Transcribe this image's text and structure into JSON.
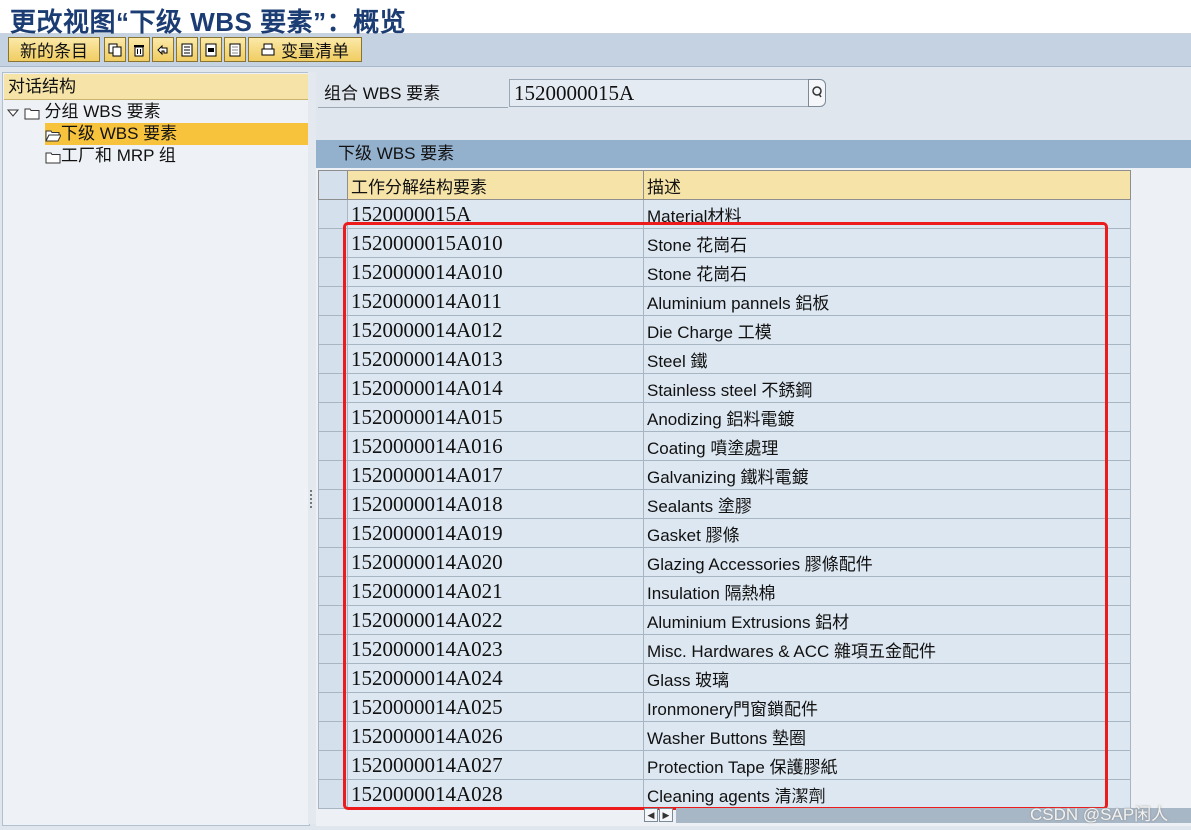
{
  "window": {
    "title": "更改视图“下级 WBS 要素”：概览"
  },
  "toolbar": {
    "new_entries": "新的条目",
    "variable_list": "变量清单",
    "icons": [
      "copy-icon",
      "delete-icon",
      "undo-icon",
      "select-all-icon",
      "select-block-icon",
      "deselect-all-icon",
      "print-icon"
    ]
  },
  "dialog_structure": {
    "header": "对话结构",
    "items": [
      {
        "label": "分组 WBS 要素",
        "level": 0,
        "expanded": true
      },
      {
        "label": "下级 WBS 要素",
        "level": 1,
        "selected": true
      },
      {
        "label": "工厂和 MRP 组",
        "level": 1
      }
    ]
  },
  "key_field": {
    "label": "组合 WBS 要素",
    "value": "1520000015A"
  },
  "table": {
    "title": "下级 WBS 要素",
    "columns": [
      "工作分解结构要素",
      "描述"
    ],
    "rows": [
      {
        "wbs": "1520000015A",
        "desc": "Material材料"
      },
      {
        "wbs": "1520000015A010",
        "desc": "Stone 花崗石"
      },
      {
        "wbs": "1520000014A010",
        "desc": "Stone 花崗石"
      },
      {
        "wbs": "1520000014A011",
        "desc": "Aluminium pannels 鋁板"
      },
      {
        "wbs": "1520000014A012",
        "desc": "Die Charge 工模"
      },
      {
        "wbs": "1520000014A013",
        "desc": "Steel 鐵"
      },
      {
        "wbs": "1520000014A014",
        "desc": "Stainless steel 不銹鋼"
      },
      {
        "wbs": "1520000014A015",
        "desc": "Anodizing 鋁料電鍍"
      },
      {
        "wbs": "1520000014A016",
        "desc": "Coating 噴塗處理"
      },
      {
        "wbs": "1520000014A017",
        "desc": "Galvanizing 鐵料電鍍"
      },
      {
        "wbs": "1520000014A018",
        "desc": "Sealants 塗膠"
      },
      {
        "wbs": "1520000014A019",
        "desc": "Gasket 膠條"
      },
      {
        "wbs": "1520000014A020",
        "desc": "Glazing Accessories 膠條配件"
      },
      {
        "wbs": "1520000014A021",
        "desc": "Insulation 隔熱棉"
      },
      {
        "wbs": "1520000014A022",
        "desc": "Aluminium Extrusions 鋁材"
      },
      {
        "wbs": "1520000014A023",
        "desc": "Misc. Hardwares & ACC 雜項五金配件"
      },
      {
        "wbs": "1520000014A024",
        "desc": "Glass 玻璃"
      },
      {
        "wbs": "1520000014A025",
        "desc": "Ironmonery門窗鎖配件"
      },
      {
        "wbs": "1520000014A026",
        "desc": "Washer Buttons 墊圈"
      },
      {
        "wbs": "1520000014A027",
        "desc": "Protection Tape 保護膠紙"
      },
      {
        "wbs": "1520000014A028",
        "desc": "Cleaning agents 清潔劑"
      }
    ]
  },
  "watermark": "CSDN @SAP闲人",
  "colors": {
    "highlight_box": "#ec1c1c",
    "selected_node": "#f7c23c",
    "header_bg": "#f5e3a7",
    "title_text": "#1b3d73"
  }
}
